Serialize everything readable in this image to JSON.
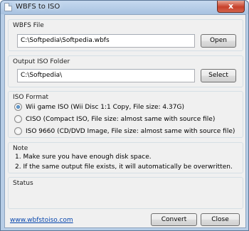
{
  "window": {
    "title": "WBFS to ISO",
    "close_glyph": "x"
  },
  "wbfs_file": {
    "label": "WBFS File",
    "value": "C:\\Softpedia\\Softpedia.wbfs",
    "button": "Open"
  },
  "output_folder": {
    "label": "Output ISO Folder",
    "value": "C:\\Softpedia\\",
    "button": "Select"
  },
  "iso_format": {
    "label": "ISO Format",
    "options": [
      {
        "label": "Wii game ISO (Wii Disc 1:1 Copy, File size: 4.37G)",
        "selected": true
      },
      {
        "label": "CISO (Compact ISO, File size: almost same with source file)",
        "selected": false
      },
      {
        "label": "ISO 9660 (CD/DVD Image, File size: almost same with source file)",
        "selected": false
      }
    ]
  },
  "note": {
    "label": "Note",
    "lines": [
      "1. Make sure you have enough disk space.",
      "2. If the same output file exists, it will automatically be overwritten."
    ]
  },
  "status": {
    "label": "Status",
    "text": ""
  },
  "footer": {
    "link": "www.wbfstoiso.com",
    "convert": "Convert",
    "close": "Close"
  }
}
